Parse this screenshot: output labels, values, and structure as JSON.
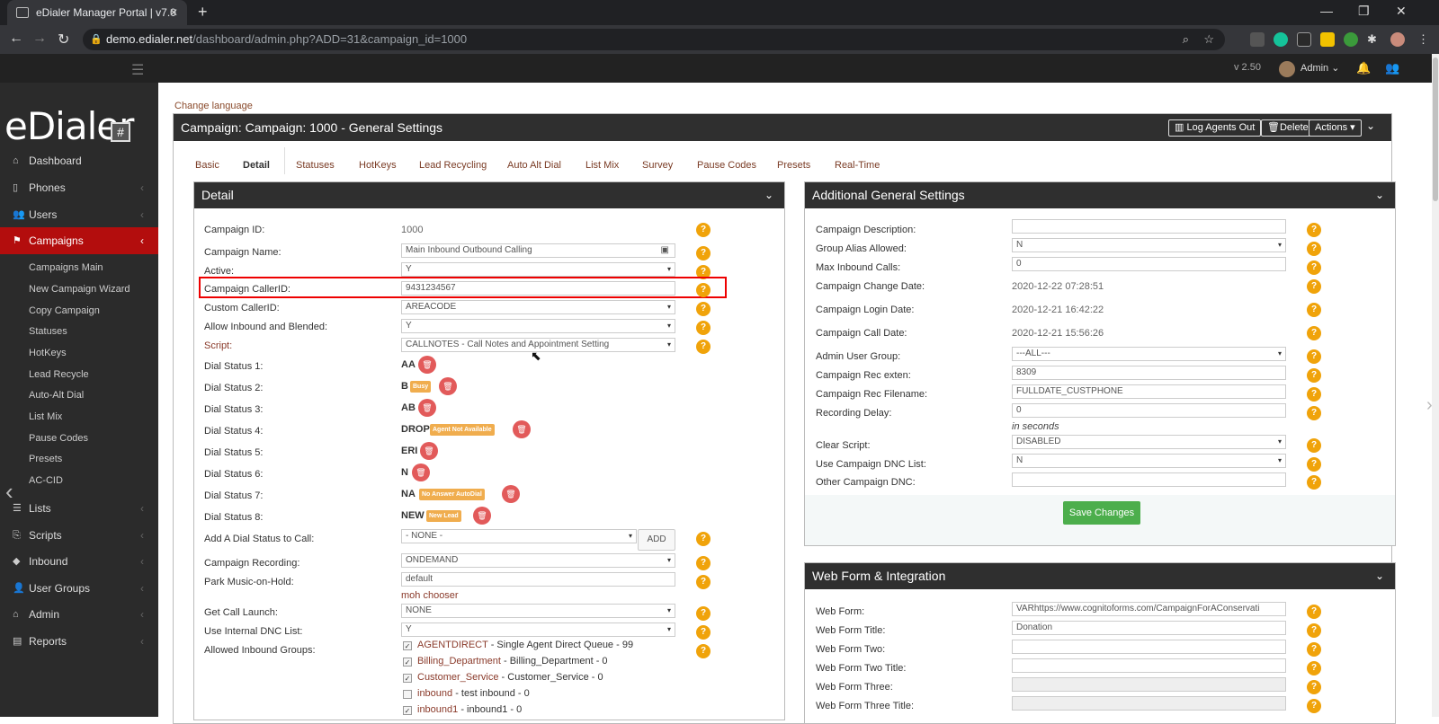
{
  "browser": {
    "tab_title": "eDialer Manager Portal | v7.0",
    "tab_close": "✕",
    "new_tab": "+",
    "url_host": "demo.edialer.net",
    "url_path": "/dashboard/admin.php?ADD=31&campaign_id=1000"
  },
  "topbar": {
    "version": "v 2.50",
    "user": "Admin"
  },
  "sidebar": {
    "logo_text": "eDialer",
    "logo_mark": "#",
    "items": [
      {
        "label": "Dashboard",
        "icon": "dashboard-icon"
      },
      {
        "label": "Phones",
        "icon": "phone-icon"
      },
      {
        "label": "Users",
        "icon": "users-icon"
      },
      {
        "label": "Campaigns",
        "icon": "flag-icon"
      },
      {
        "label": "Lists",
        "icon": "list-icon"
      },
      {
        "label": "Scripts",
        "icon": "scripts-icon"
      },
      {
        "label": "Inbound",
        "icon": "inbound-icon"
      },
      {
        "label": "User Groups",
        "icon": "user-groups-icon"
      },
      {
        "label": "Admin",
        "icon": "admin-icon"
      },
      {
        "label": "Reports",
        "icon": "reports-icon"
      }
    ],
    "sub_items": [
      "Campaigns Main",
      "New Campaign Wizard",
      "Copy Campaign",
      "Statuses",
      "HotKeys",
      "Lead Recycle",
      "Auto-Alt Dial",
      "List Mix",
      "Pause Codes",
      "Presets",
      "AC-CID"
    ]
  },
  "main": {
    "change_language": "Change language",
    "title": "Campaign: Campaign: 1000 - General Settings",
    "buttons": {
      "log_agents_out": "Log Agents Out",
      "delete": "Delete",
      "actions": "Actions"
    },
    "tabs": [
      "Basic",
      "Detail",
      "Statuses",
      "HotKeys",
      "Lead Recycling",
      "Auto Alt Dial",
      "List Mix",
      "Survey",
      "Pause Codes",
      "Presets",
      "Real-Time"
    ]
  },
  "detail": {
    "title": "Detail",
    "campaign_id_label": "Campaign ID:",
    "campaign_id": "1000",
    "campaign_name_label": "Campaign Name:",
    "campaign_name": "Main Inbound Outbound Calling",
    "active_label": "Active:",
    "active": "Y",
    "callerid_label": "Campaign CallerID:",
    "callerid": "9431234567",
    "custom_callerid_label": "Custom CallerID:",
    "custom_callerid": "AREACODE",
    "allow_inbound_label": "Allow Inbound and Blended:",
    "allow_inbound": "Y",
    "script_label": "Script:",
    "script": "CALLNOTES - Call Notes and Appointment Setting",
    "dial_statuses": [
      {
        "label": "Dial Status 1:",
        "code": "AA",
        "tag": ""
      },
      {
        "label": "Dial Status 2:",
        "code": "B",
        "tag": "Busy"
      },
      {
        "label": "Dial Status 3:",
        "code": "AB",
        "tag": ""
      },
      {
        "label": "Dial Status 4:",
        "code": "DROP",
        "tag": "Agent Not Available"
      },
      {
        "label": "Dial Status 5:",
        "code": "ERI",
        "tag": ""
      },
      {
        "label": "Dial Status 6:",
        "code": "N",
        "tag": ""
      },
      {
        "label": "Dial Status 7:",
        "code": "NA",
        "tag": "No Answer AutoDial"
      },
      {
        "label": "Dial Status 8:",
        "code": "NEW",
        "tag": "New Lead"
      }
    ],
    "add_dial_label": "Add A Dial Status to Call:",
    "add_dial_value": "- NONE -",
    "add_button": "ADD",
    "recording_label": "Campaign Recording:",
    "recording": "ONDEMAND",
    "park_label": "Park Music-on-Hold:",
    "park": "default",
    "moh_chooser": "moh chooser",
    "call_launch_label": "Get Call Launch:",
    "call_launch": "NONE",
    "dnc_label": "Use Internal DNC List:",
    "dnc": "Y",
    "inbound_groups_label": "Allowed Inbound Groups:",
    "inbound_groups": [
      {
        "name": "AGENTDIRECT",
        "desc": " - Single Agent Direct Queue - 99"
      },
      {
        "name": "Billing_Department",
        "desc": " - Billing_Department - 0"
      },
      {
        "name": "Customer_Service",
        "desc": " - Customer_Service - 0"
      },
      {
        "name": "inbound",
        "desc": " - test inbound - 0"
      },
      {
        "name": "inbound1",
        "desc": " - inbound1 - 0"
      }
    ]
  },
  "additional": {
    "title": "Additional General Settings",
    "description_label": "Campaign Description:",
    "description": "",
    "group_alias_label": "Group Alias Allowed:",
    "group_alias": "N",
    "max_inbound_label": "Max Inbound Calls:",
    "max_inbound": "0",
    "change_date_label": "Campaign Change Date:",
    "change_date": "2020-12-22 07:28:51",
    "login_date_label": "Campaign Login Date:",
    "login_date": "2020-12-21 16:42:22",
    "call_date_label": "Campaign Call Date:",
    "call_date": "2020-12-21 15:56:26",
    "admin_group_label": "Admin User Group:",
    "admin_group": "---ALL---",
    "rec_exten_label": "Campaign Rec exten:",
    "rec_exten": "8309",
    "rec_filename_label": "Campaign Rec Filename:",
    "rec_filename": "FULLDATE_CUSTPHONE",
    "rec_delay_label": "Recording Delay:",
    "rec_delay": "0",
    "in_seconds": "in seconds",
    "clear_script_label": "Clear Script:",
    "clear_script": "DISABLED",
    "dnc_list_label": "Use Campaign DNC List:",
    "dnc_list": "N",
    "other_dnc_label": "Other Campaign DNC:",
    "other_dnc": "",
    "save": "Save Changes"
  },
  "webform": {
    "title": "Web Form & Integration",
    "web_form_label": "Web Form:",
    "web_form": "VARhttps://www.cognitoforms.com/CampaignForAConservati",
    "web_form_title_label": "Web Form Title:",
    "web_form_title": "Donation",
    "web_form_two_label": "Web Form Two:",
    "web_form_two_title_label": "Web Form Two Title:",
    "web_form_three_label": "Web Form Three:",
    "web_form_three_title_label": "Web Form Three Title:"
  },
  "colors": {
    "accent_red": "#b30d0d",
    "help_orange": "#f0a30a",
    "save_green": "#4cae4c",
    "header_dark": "#2f2f2f"
  }
}
